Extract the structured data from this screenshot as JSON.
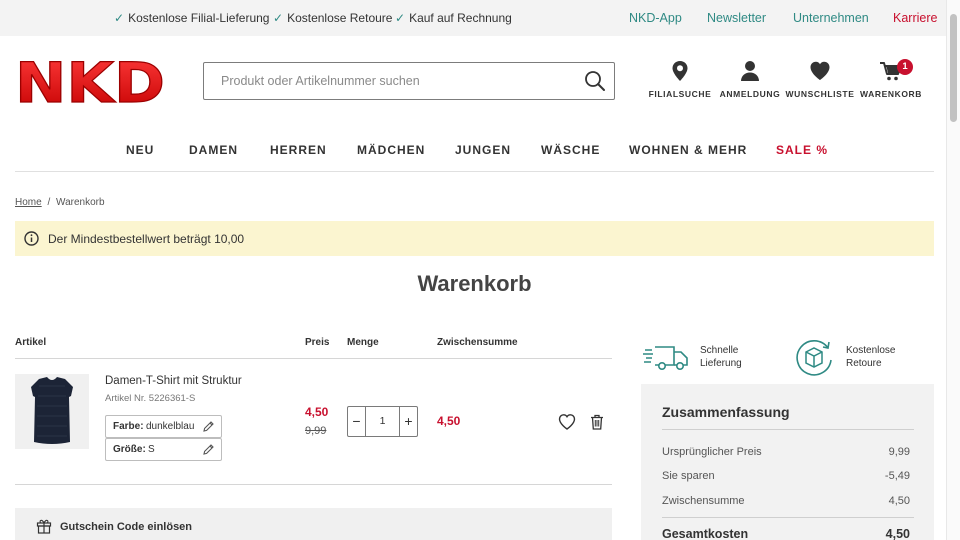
{
  "topbar": {
    "usps": [
      "Kostenlose Filial-Lieferung",
      "Kostenlose Retoure",
      "Kauf auf Rechnung"
    ],
    "links": [
      "NKD-App",
      "Newsletter",
      "Unternehmen",
      "Karriere"
    ]
  },
  "header": {
    "logo_text": "NKD",
    "search_placeholder": "Produkt oder Artikelnummer suchen",
    "icons": {
      "store": "FILIALSUCHE",
      "account": "ANMELDUNG",
      "wishlist": "WUNSCHLISTE",
      "cart": "WARENKORB",
      "cart_count": "1"
    }
  },
  "nav": [
    "NEU",
    "DAMEN",
    "HERREN",
    "MÄDCHEN",
    "JUNGEN",
    "WÄSCHE",
    "WOHNEN & MEHR",
    "SALE %"
  ],
  "breadcrumb": {
    "home": "Home",
    "sep": "/",
    "current": "Warenkorb"
  },
  "notice": "Der Mindestbestellwert beträgt 10,00",
  "page_title": "Warenkorb",
  "table": {
    "headers": {
      "article": "Artikel",
      "price": "Preis",
      "qty": "Menge",
      "subtotal": "Zwischensumme"
    },
    "item": {
      "name": "Damen-T-Shirt mit Struktur",
      "article_no": "Artikel Nr. 5226361-S",
      "color_label": "Farbe:",
      "color_value": "dunkelblau",
      "size_label": "Größe:",
      "size_value": "S",
      "price_new": "4,50",
      "price_old": "9,99",
      "qty": "1",
      "minus": "−",
      "plus": "+",
      "subtotal": "4,50"
    }
  },
  "voucher": "Gutschein Code einlösen",
  "features": [
    {
      "line1": "Schnelle",
      "line2": "Lieferung"
    },
    {
      "line1": "Kostenlose",
      "line2": "Retoure"
    }
  ],
  "summary": {
    "title": "Zusammenfassung",
    "rows": [
      {
        "label": "Ursprünglicher Preis",
        "value": "9,99"
      },
      {
        "label": "Sie sparen",
        "value": "-5,49"
      },
      {
        "label": "Zwischensumme",
        "value": "4,50"
      }
    ],
    "total_label": "Gesamtkosten",
    "total_value": "4,50"
  },
  "colors": {
    "brand_red": "#c8102e",
    "teal": "#2f8a84",
    "notice_bg": "#fbf5d0"
  }
}
